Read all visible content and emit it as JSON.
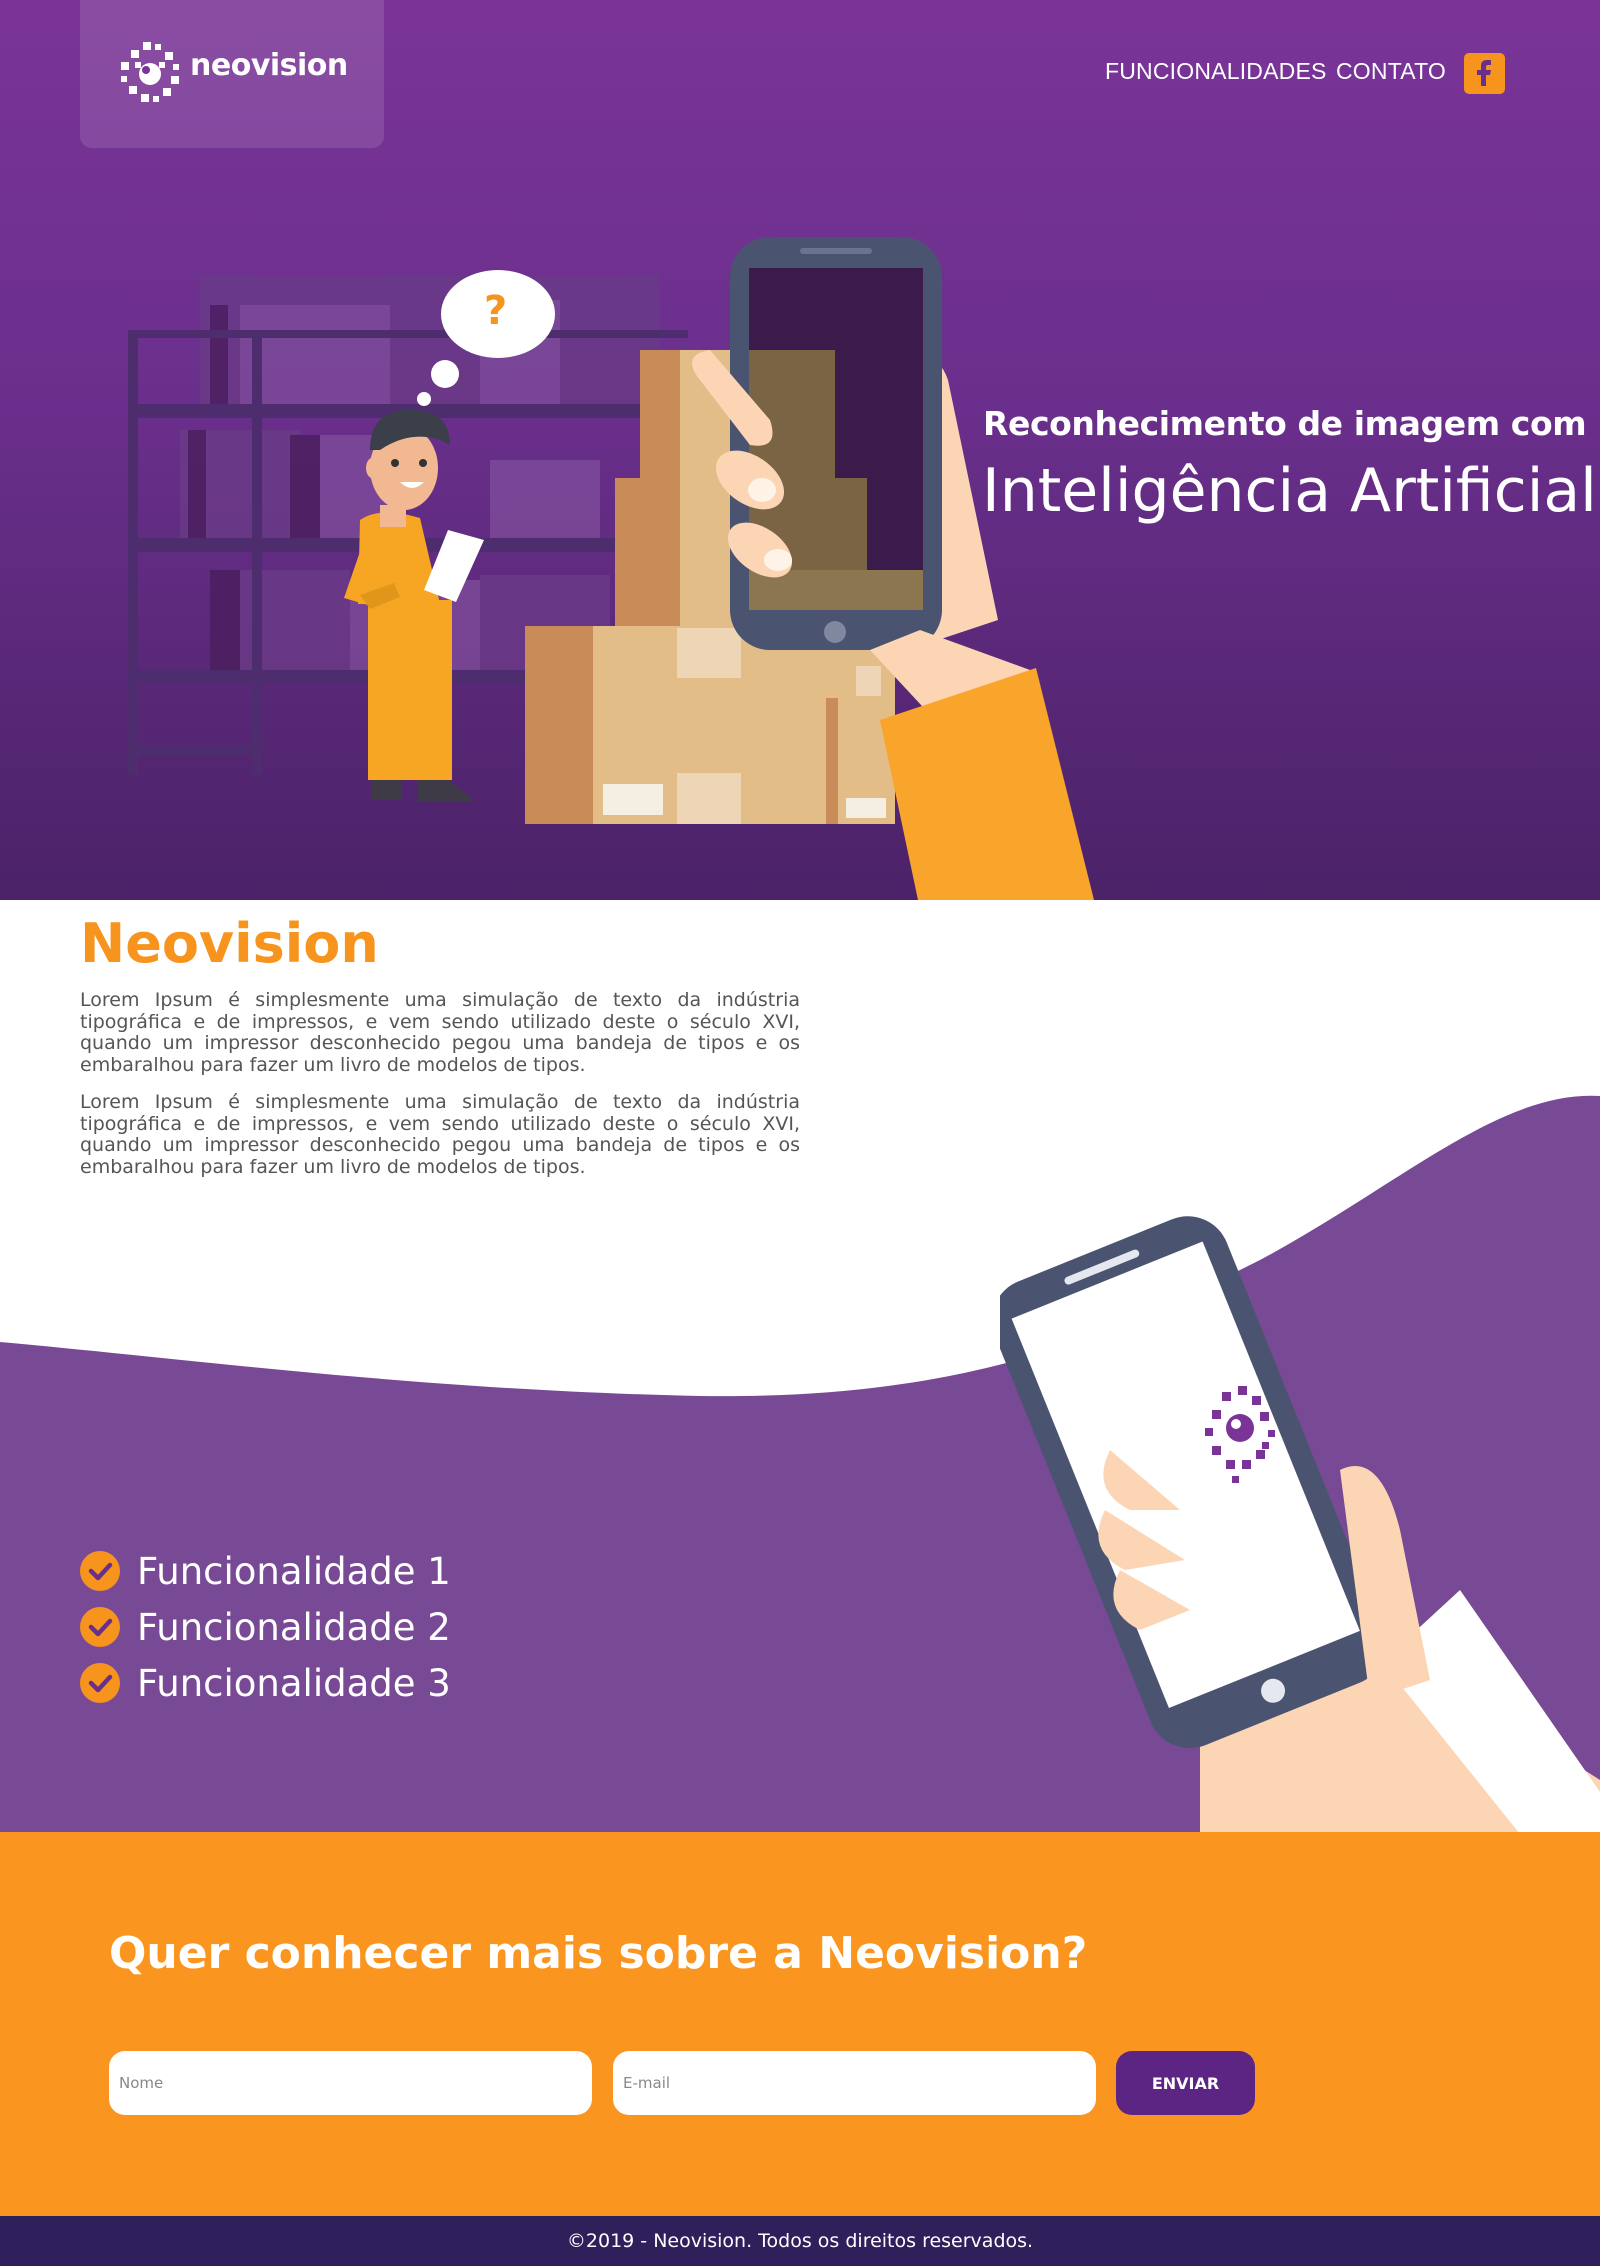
{
  "brand": {
    "logo_text": "neovision",
    "colors": {
      "purple": "#6a2f8c",
      "orange": "#f7941e",
      "dark": "#2f1f5a"
    }
  },
  "nav": {
    "items": [
      {
        "label": "FUNCIONALIDADES"
      },
      {
        "label": "CONTATO"
      }
    ],
    "social_icon": "facebook-icon"
  },
  "hero": {
    "subtitle": "Reconhecimento de imagem com",
    "title": "Inteligência Artificial",
    "bubble_text": "?"
  },
  "about": {
    "title": "Neovision",
    "paragraphs": [
      "Lorem Ipsum é simplesmente uma simulação de texto da indústria tipográfica e de impressos, e vem sendo utilizado deste o século XVI, quando um impressor desconhecido pegou uma bandeja de tipos e os embaralhou para fazer um livro de modelos de tipos.",
      "Lorem Ipsum é simplesmente uma simulação de texto da indústria tipográfica e de impressos, e vem sendo utilizado deste o século XVI, quando um impressor desconhecido pegou uma bandeja de tipos e os embaralhou para fazer um livro de modelos de tipos."
    ]
  },
  "features": {
    "items": [
      {
        "label": "Funcionalidade 1"
      },
      {
        "label": "Funcionalidade 2"
      },
      {
        "label": "Funcionalidade 3"
      }
    ]
  },
  "cta": {
    "title": "Quer conhecer mais sobre a Neovision?",
    "name_placeholder": "Nome",
    "email_placeholder": "E-mail",
    "send_label": "ENVIAR"
  },
  "footer": {
    "text": "©2019 - Neovision. Todos os direitos reservados."
  }
}
